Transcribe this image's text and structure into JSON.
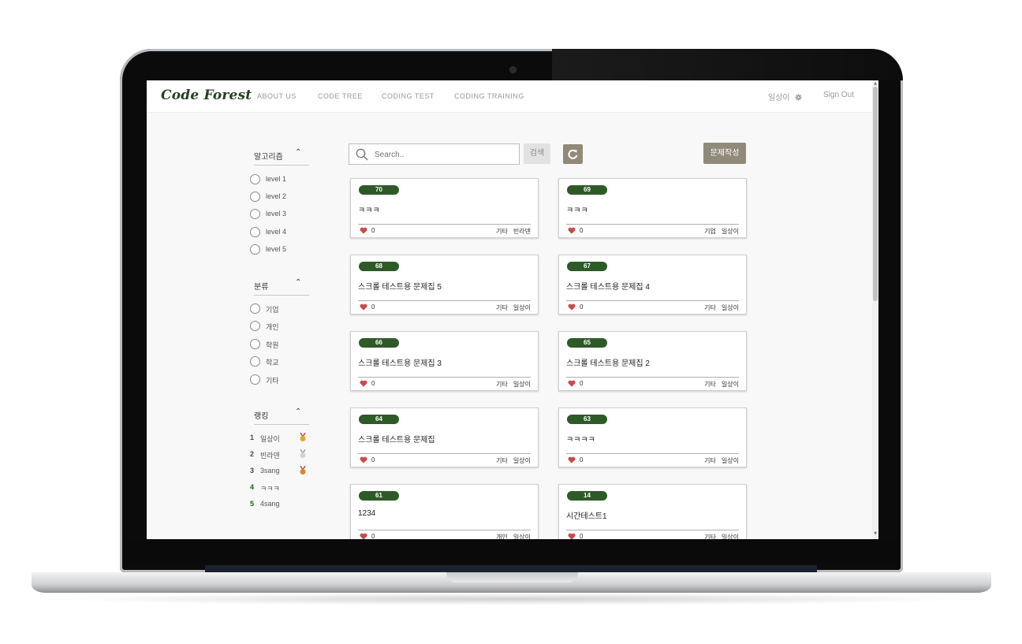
{
  "brand": "Code Forest",
  "nav": {
    "links": [
      "ABOUT US",
      "CODE TREE",
      "CODING TEST",
      "CODING TRAINING"
    ],
    "user": "일상이",
    "sign_out": "Sign Out"
  },
  "sidebar": {
    "algorithm": {
      "title": "알고리즘",
      "items": [
        "level 1",
        "level 2",
        "level 3",
        "level 4",
        "level 5"
      ]
    },
    "category": {
      "title": "분류",
      "items": [
        "기업",
        "개인",
        "학원",
        "학교",
        "기타"
      ]
    },
    "ranking": {
      "title": "랭킹",
      "items": [
        {
          "rank": "1",
          "user": "일상이",
          "medal": "gold"
        },
        {
          "rank": "2",
          "user": "빈라덴",
          "medal": "silver"
        },
        {
          "rank": "3",
          "user": "3sang",
          "medal": "bronze"
        },
        {
          "rank": "4",
          "user": "ㅋㅋㅋ",
          "medal": ""
        },
        {
          "rank": "5",
          "user": "4sang",
          "medal": ""
        }
      ]
    }
  },
  "search": {
    "placeholder": "Search..",
    "button": "검색",
    "write_button": "문제작성"
  },
  "cards": [
    {
      "id": "70",
      "title": "ㅋㅋㅋ",
      "likes": "0",
      "category": "기타",
      "author": "빈라덴"
    },
    {
      "id": "69",
      "title": "ㅋㅋㅋ",
      "likes": "0",
      "category": "기업",
      "author": "일상이"
    },
    {
      "id": "68",
      "title": "스크롤 테스트용 문제집 5",
      "likes": "0",
      "category": "기타",
      "author": "일상이"
    },
    {
      "id": "67",
      "title": "스크롤 테스트용 문제집 4",
      "likes": "0",
      "category": "기타",
      "author": "일상이"
    },
    {
      "id": "66",
      "title": "스크롤 테스트용 문제집 3",
      "likes": "0",
      "category": "기타",
      "author": "일상이"
    },
    {
      "id": "65",
      "title": "스크롤 테스트용 문제집 2",
      "likes": "0",
      "category": "기타",
      "author": "일상이"
    },
    {
      "id": "64",
      "title": "스크롤 테스트용 문제집",
      "likes": "0",
      "category": "기타",
      "author": "일상이"
    },
    {
      "id": "63",
      "title": "ㅋㅋㅋㅋ",
      "likes": "0",
      "category": "기타",
      "author": "일상이"
    },
    {
      "id": "61",
      "title": "1234",
      "likes": "0",
      "category": "개인",
      "author": "일상이"
    },
    {
      "id": "14",
      "title": "시간테스트1",
      "likes": "0",
      "category": "기타",
      "author": "일상이"
    }
  ],
  "colors": {
    "brand_green": "#2d5a27",
    "button_taupe": "#8f8a7a",
    "heart_red": "#c94a4a"
  }
}
